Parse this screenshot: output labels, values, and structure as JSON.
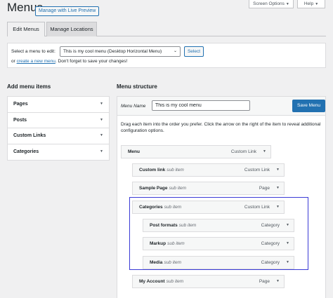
{
  "header": {
    "title": "Menus",
    "live_preview": "Manage with Live Preview",
    "screen_options": "Screen Options",
    "help": "Help"
  },
  "tabs": [
    {
      "label": "Edit Menus",
      "active": true
    },
    {
      "label": "Manage Locations",
      "active": false
    }
  ],
  "select_bar": {
    "label": "Select a menu to edit:",
    "selected": "This is my cool menu (Desktop Horizontal Menu)",
    "select_button": "Select",
    "or": "or",
    "create_link": "create a new menu",
    "create_suffix": ". Don't forget to save your changes!"
  },
  "add_items": {
    "heading": "Add menu items",
    "sections": [
      "Pages",
      "Posts",
      "Custom Links",
      "Categories"
    ]
  },
  "structure": {
    "heading": "Menu structure",
    "name_label": "Menu Name",
    "name_value": "This is my cool menu",
    "save_label": "Save Menu",
    "instructions": "Drag each item into the order you prefer. Click the arrow on the right of the item to reveal additional configuration options.",
    "items": [
      {
        "title": "Menu",
        "sub": "",
        "type": "Custom Link"
      },
      {
        "title": "Custom link",
        "sub": "sub item",
        "type": "Custom Link"
      },
      {
        "title": "Sample Page",
        "sub": "sub item",
        "type": "Page"
      },
      {
        "title": "Categories",
        "sub": "sub item",
        "type": "Custom Link"
      },
      {
        "title": "Post formats",
        "sub": "sub item",
        "type": "Category"
      },
      {
        "title": "Markup",
        "sub": "sub item",
        "type": "Category"
      },
      {
        "title": "Media",
        "sub": "sub item",
        "type": "Category"
      },
      {
        "title": "My Account",
        "sub": "sub item",
        "type": "Page"
      }
    ]
  },
  "colors": {
    "accent": "#2271b1",
    "highlight": "#3b3bd6"
  }
}
